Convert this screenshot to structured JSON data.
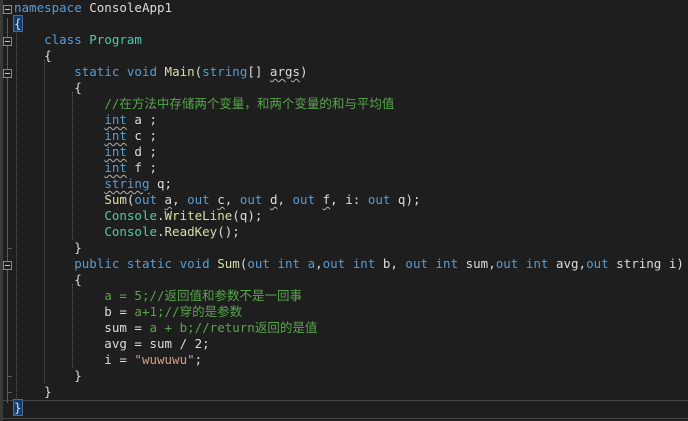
{
  "editor": {
    "lines": [
      {
        "text": "namespace ConsoleApp1"
      },
      {
        "text": "{"
      },
      {
        "text": "    class Program"
      },
      {
        "text": "    {"
      },
      {
        "text": "        static void Main(string[] args)"
      },
      {
        "text": "        {"
      },
      {
        "text": "            //在方法中存储两个变量，和两个变量的和与平均值"
      },
      {
        "text": "            int a ;"
      },
      {
        "text": "            int c ;"
      },
      {
        "text": "            int d ;"
      },
      {
        "text": "            int f ;"
      },
      {
        "text": "            string q;"
      },
      {
        "text": "            Sum(out a, out c, out d, out f, i: out q);"
      },
      {
        "text": "            Console.WriteLine(q);"
      },
      {
        "text": "            Console.ReadKey();"
      },
      {
        "text": "        }"
      },
      {
        "text": "        public static void Sum(out int a,out int b, out int sum,out int avg,out string i)"
      },
      {
        "text": "        {"
      },
      {
        "text": "            a = 5;//返回值和参数不是一回事"
      },
      {
        "text": "            b = a+1;//穿的是参数"
      },
      {
        "text": "            sum = a + b;//return返回的是值"
      },
      {
        "text": "            avg = sum / 2;"
      },
      {
        "text": "            i = \"wuwuwu\";"
      },
      {
        "text": "        }"
      },
      {
        "text": "    }"
      },
      {
        "text": "}"
      }
    ]
  },
  "colors": {
    "background": "#1e1e1e",
    "keyword": "#569cd6",
    "type": "#4ec9b0",
    "comment": "#57a64a",
    "string": "#d69d85",
    "method": "#dcdcaa",
    "text": "#dcdcdc"
  }
}
